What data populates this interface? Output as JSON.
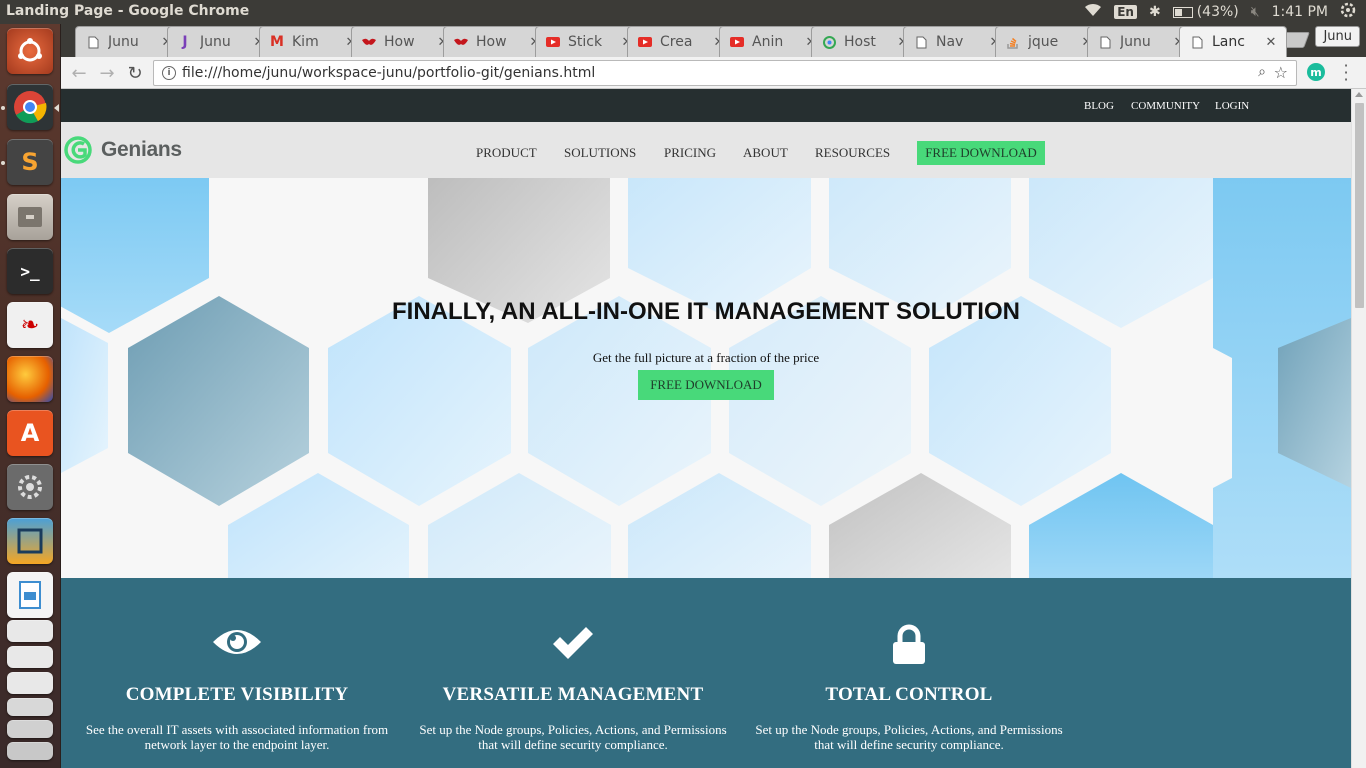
{
  "window": {
    "title": "Landing Page - Google Chrome"
  },
  "system_tray": {
    "language": "En",
    "battery": "(43%)",
    "time": "1:41 PM"
  },
  "tabs": [
    {
      "label": "Junu",
      "icon": "document-icon"
    },
    {
      "label": "Junu",
      "icon": "j-logo-icon"
    },
    {
      "label": "Kim",
      "icon": "gmail-icon"
    },
    {
      "label": "How",
      "icon": "red-bird-icon"
    },
    {
      "label": "How",
      "icon": "red-bird-icon"
    },
    {
      "label": "Stick",
      "icon": "youtube-icon"
    },
    {
      "label": "Crea",
      "icon": "youtube-icon"
    },
    {
      "label": "Anin",
      "icon": "youtube-icon"
    },
    {
      "label": "Host",
      "icon": "google-drive-icon"
    },
    {
      "label": "Nav",
      "icon": "document-icon"
    },
    {
      "label": "jque",
      "icon": "stackoverflow-icon"
    },
    {
      "label": "Junu",
      "icon": "document-icon"
    },
    {
      "label": "Lanc",
      "icon": "document-icon"
    }
  ],
  "profile": {
    "name": "Junu"
  },
  "omnibox": {
    "url": "file:///home/junu/workspace-junu/portfolio-git/genians.html",
    "extension_label": "m"
  },
  "utility_nav": {
    "blog": "BLOG",
    "community": "COMMUNITY",
    "login": "LOGIN"
  },
  "brand": {
    "name": "Genians",
    "color": "#48d97a"
  },
  "main_nav": {
    "product": "PRODUCT",
    "solutions": "SOLUTIONS",
    "pricing": "PRICING",
    "about": "ABOUT",
    "resources": "RESOURCES",
    "cta": "FREE DOWNLOAD"
  },
  "hero": {
    "title": "FINALLY, AN ALL-IN-ONE IT MANAGEMENT SOLUTION",
    "subtitle": "Get the full picture at a fraction of the price",
    "cta": "FREE DOWNLOAD"
  },
  "features": [
    {
      "icon": "eye-icon",
      "title": "COMPLETE VISIBILITY",
      "desc": "See the overall IT assets with associated information from network layer to the endpoint layer."
    },
    {
      "icon": "checkmark-icon",
      "title": "VERSATILE MANAGEMENT",
      "desc": "Set up the Node groups, Policies, Actions, and Permissions that will define security compliance."
    },
    {
      "icon": "lock-icon",
      "title": "TOTAL CONTROL",
      "desc": "Set up the Node groups, Policies, Actions, and Permissions that will define security compliance."
    }
  ],
  "colors": {
    "utility_bar": "#262f30",
    "nav_bar": "#e6e6e6",
    "cta": "#48d97a",
    "features_bg": "#336d80"
  }
}
